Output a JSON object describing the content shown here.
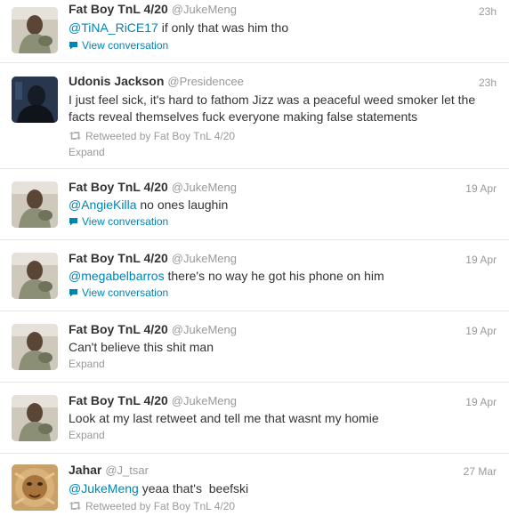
{
  "tweets": [
    {
      "name": "Fat Boy TnL 4/20",
      "handle": "@JukeMeng",
      "time": "23h",
      "mention": "@TiNA_RiCE17",
      "text": " if only that was him tho",
      "meta": "View conversation",
      "avatar": "fatboy"
    },
    {
      "name": "Udonis Jackson",
      "handle": "@Presidencee",
      "time": "23h",
      "mention": "",
      "text": "I just feel sick, it's hard to fathom Jizz was a peaceful weed smoker let the facts reveal themselves fuck everyone making false statements",
      "retweet": "Retweeted by Fat Boy TnL 4/20",
      "meta": "Expand",
      "avatar": "udonis"
    },
    {
      "name": "Fat Boy TnL 4/20",
      "handle": "@JukeMeng",
      "time": "19 Apr",
      "mention": "@AngieKilla",
      "text": " no ones laughin",
      "meta": "View conversation",
      "avatar": "fatboy"
    },
    {
      "name": "Fat Boy TnL 4/20",
      "handle": "@JukeMeng",
      "time": "19 Apr",
      "mention": "@megabelbarros",
      "text": " there's no way he got his phone on him",
      "meta": "View conversation",
      "avatar": "fatboy"
    },
    {
      "name": "Fat Boy TnL 4/20",
      "handle": "@JukeMeng",
      "time": "19 Apr",
      "mention": "",
      "text": "Can't believe this shit man",
      "meta": "Expand",
      "avatar": "fatboy"
    },
    {
      "name": "Fat Boy TnL 4/20",
      "handle": "@JukeMeng",
      "time": "19 Apr",
      "mention": "",
      "text": "Look at my last retweet and tell me that wasnt my homie",
      "meta": "Expand",
      "avatar": "fatboy"
    },
    {
      "name": "Jahar",
      "handle": "@J_tsar",
      "time": "27 Mar",
      "mention": "@JukeMeng",
      "text": " yeaa that's  beefski",
      "retweet": "Retweeted by Fat Boy TnL 4/20",
      "avatar": "jahar"
    }
  ],
  "colors": {
    "link": "#0084b4",
    "name": "#333333",
    "muted": "#999999",
    "divider": "#e8e8e8"
  },
  "icons": {
    "conversation": "speech-bubble-icon",
    "retweet": "retweet-icon"
  }
}
